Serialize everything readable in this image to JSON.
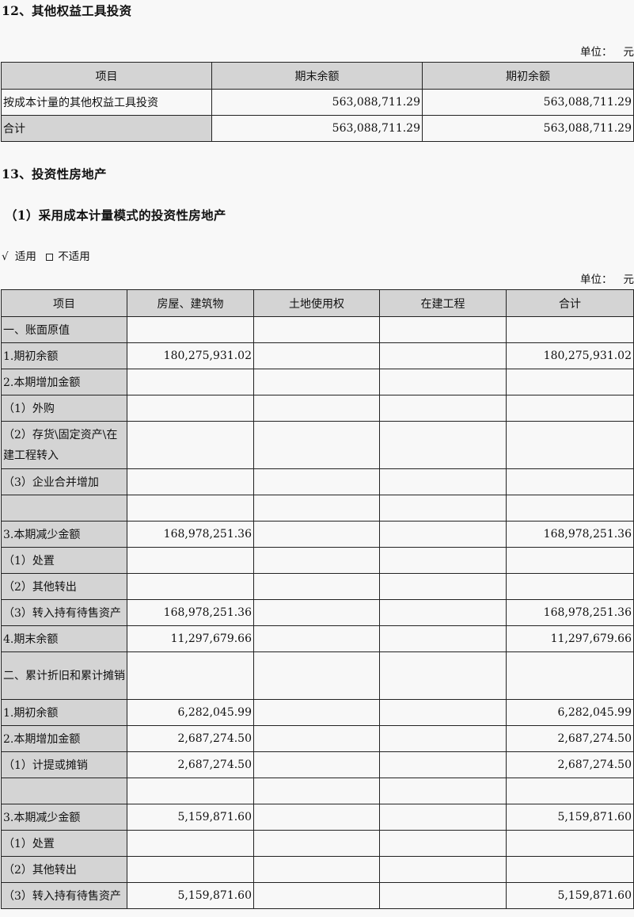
{
  "section12": {
    "heading": "12、其他权益工具投资",
    "unit": {
      "label": "单位：",
      "value": "元"
    },
    "headers": [
      "项目",
      "期末余额",
      "期初余额"
    ],
    "rows": [
      {
        "label": "按成本计量的其他权益工具投资",
        "end": "563,088,711.29",
        "begin": "563,088,711.29"
      },
      {
        "label": "合计",
        "end": "563,088,711.29",
        "begin": "563,088,711.29"
      }
    ]
  },
  "section13": {
    "heading": "13、投资性房地产",
    "subheading": "（1）采用成本计量模式的投资性房地产",
    "applicability": {
      "checked_mark": "√",
      "applicable": "适用",
      "not_applicable": "不适用"
    },
    "unit": {
      "label": "单位：",
      "value": "元"
    },
    "headers": [
      "项目",
      "房屋、建筑物",
      "土地使用权",
      "在建工程",
      "合计"
    ],
    "rows": [
      {
        "label": "一、账面原值",
        "buildings": "",
        "land": "",
        "construction": "",
        "total": ""
      },
      {
        "label": "1.期初余额",
        "buildings": "180,275,931.02",
        "land": "",
        "construction": "",
        "total": "180,275,931.02"
      },
      {
        "label": "2.本期增加金额",
        "buildings": "",
        "land": "",
        "construction": "",
        "total": ""
      },
      {
        "label": "（1）外购",
        "buildings": "",
        "land": "",
        "construction": "",
        "total": ""
      },
      {
        "label": "（2）存货\\固定资产\\在建工程转入",
        "buildings": "",
        "land": "",
        "construction": "",
        "total": ""
      },
      {
        "label": "（3）企业合并增加",
        "buildings": "",
        "land": "",
        "construction": "",
        "total": ""
      },
      {
        "label": "",
        "buildings": "",
        "land": "",
        "construction": "",
        "total": ""
      },
      {
        "label": "3.本期减少金额",
        "buildings": "168,978,251.36",
        "land": "",
        "construction": "",
        "total": "168,978,251.36"
      },
      {
        "label": "（1）处置",
        "buildings": "",
        "land": "",
        "construction": "",
        "total": ""
      },
      {
        "label": "（2）其他转出",
        "buildings": "",
        "land": "",
        "construction": "",
        "total": ""
      },
      {
        "label": "（3）转入持有待售资产",
        "buildings": "168,978,251.36",
        "land": "",
        "construction": "",
        "total": "168,978,251.36"
      },
      {
        "label": "4.期末余额",
        "buildings": "11,297,679.66",
        "land": "",
        "construction": "",
        "total": "11,297,679.66"
      },
      {
        "label": "二、累计折旧和累计摊销",
        "buildings": "",
        "land": "",
        "construction": "",
        "total": ""
      },
      {
        "label": "1.期初余额",
        "buildings": "6,282,045.99",
        "land": "",
        "construction": "",
        "total": "6,282,045.99"
      },
      {
        "label": "2.本期增加金额",
        "buildings": "2,687,274.50",
        "land": "",
        "construction": "",
        "total": "2,687,274.50"
      },
      {
        "label": "（1）计提或摊销",
        "buildings": "2,687,274.50",
        "land": "",
        "construction": "",
        "total": "2,687,274.50"
      },
      {
        "label": "",
        "buildings": "",
        "land": "",
        "construction": "",
        "total": ""
      },
      {
        "label": "3.本期减少金额",
        "buildings": "5,159,871.60",
        "land": "",
        "construction": "",
        "total": "5,159,871.60"
      },
      {
        "label": "（1）处置",
        "buildings": "",
        "land": "",
        "construction": "",
        "total": ""
      },
      {
        "label": "（2）其他转出",
        "buildings": "",
        "land": "",
        "construction": "",
        "total": ""
      },
      {
        "label": "（3）转入持有待售资产",
        "buildings": "5,159,871.60",
        "land": "",
        "construction": "",
        "total": "5,159,871.60"
      }
    ]
  }
}
